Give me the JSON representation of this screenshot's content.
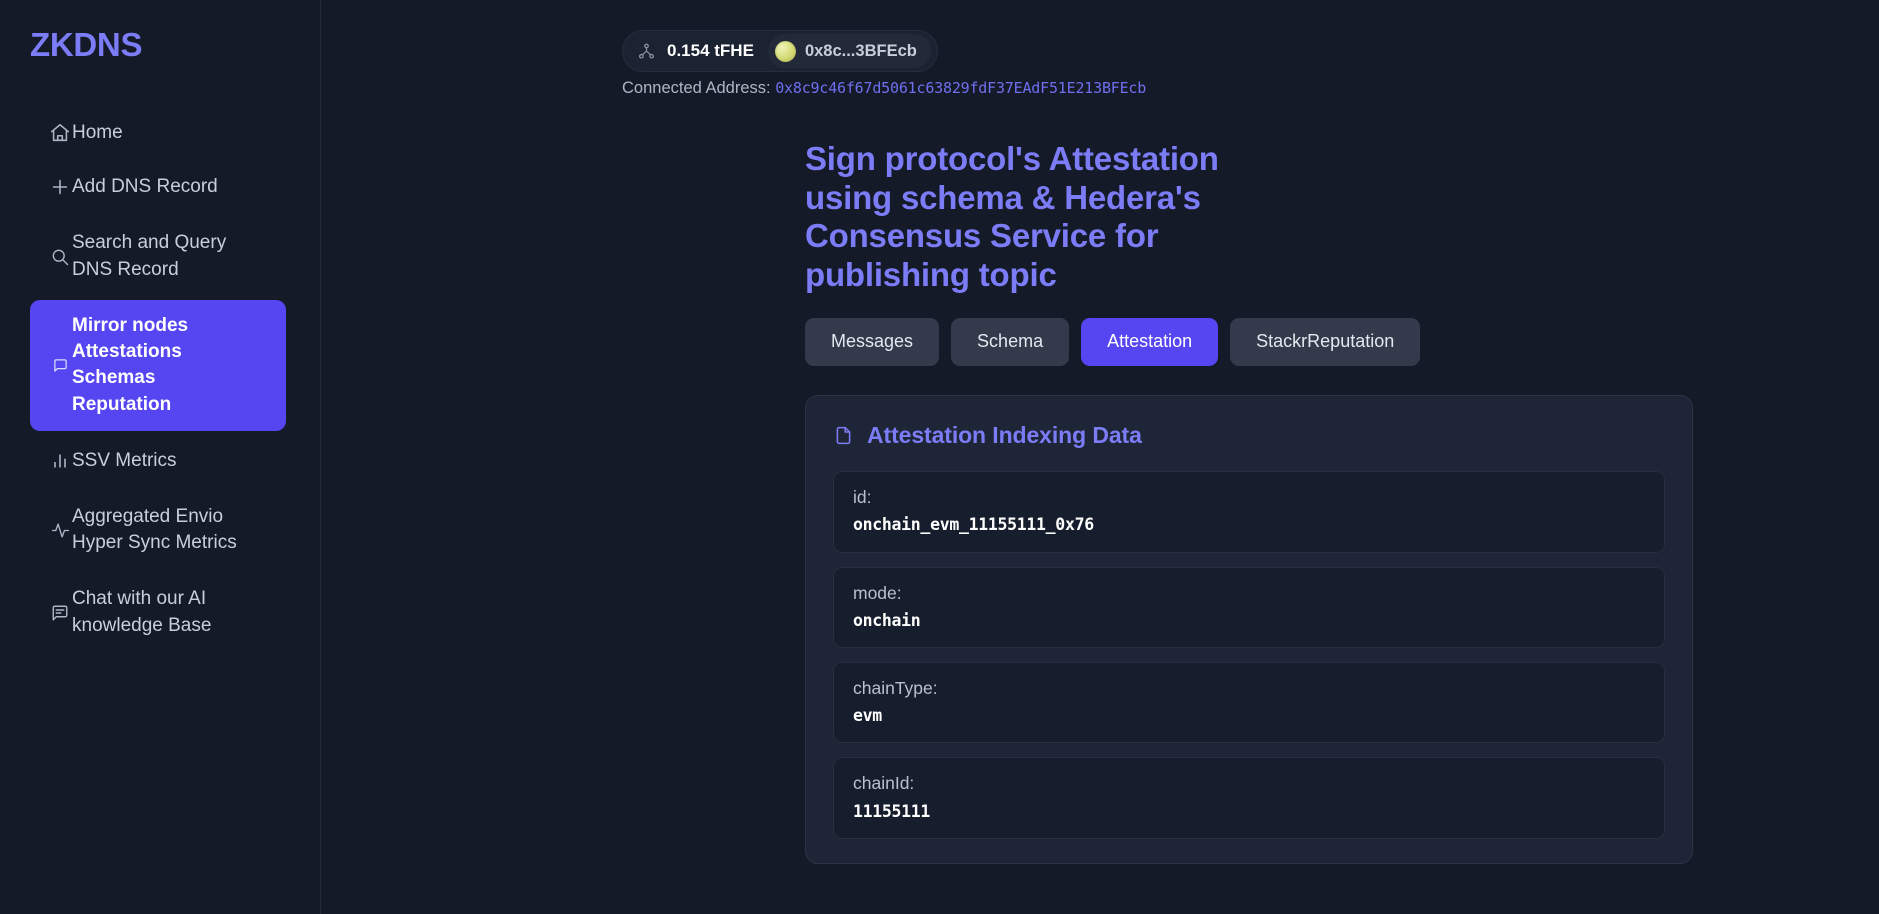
{
  "brand": "ZKDNS",
  "sidebar": {
    "items": [
      {
        "label": "Home",
        "icon": "home-icon",
        "name": "home",
        "active": false
      },
      {
        "label": "Add DNS Record",
        "icon": "plus-icon",
        "name": "add-dns-record",
        "active": false
      },
      {
        "label": "Search and Query\nDNS Record",
        "icon": "search-icon",
        "name": "search-and-query-dns-record",
        "active": false
      },
      {
        "label": "Mirror nodes\nAttestations Schemas\nReputation",
        "icon": "message-square-icon",
        "name": "mirror-nodes-attestations-schemas-reputation",
        "active": true
      },
      {
        "label": "SSV Metrics",
        "icon": "bar-chart-icon",
        "name": "ssv-metrics",
        "active": false
      },
      {
        "label": "Aggregated Envio\nHyper Sync Metrics",
        "icon": "activity-icon",
        "name": "aggregated-envio-hyper-sync-metrics",
        "active": false
      },
      {
        "label": "Chat with our AI\nknowledge Base",
        "icon": "chat-icon",
        "name": "chat-with-our-ai-knowledge-base",
        "active": false
      }
    ]
  },
  "wallet": {
    "balance": "0.154 tFHE",
    "account_short": "0x8c...3BFEcb",
    "connected_label": "Connected Address:",
    "connected_address": "0x8c9c46f67d5061c63829fdF37EAdF51E213BFEcb"
  },
  "main": {
    "page_title": "Sign protocol's Attestation using schema & Hedera's Consensus Service for publishing topic",
    "tabs": [
      {
        "label": "Messages",
        "active": false
      },
      {
        "label": "Schema",
        "active": false
      },
      {
        "label": "Attestation",
        "active": true
      },
      {
        "label": "StackrReputation",
        "active": false
      }
    ],
    "card": {
      "title": "Attestation Indexing Data",
      "rows": [
        {
          "key": "id:",
          "value": "onchain_evm_11155111_0x76"
        },
        {
          "key": "mode:",
          "value": "onchain"
        },
        {
          "key": "chainType:",
          "value": "evm"
        },
        {
          "key": "chainId:",
          "value": "11155111"
        }
      ]
    }
  },
  "colors": {
    "accent": "#5546f2",
    "accent_text": "#7c7cf7",
    "page_bg": "#141a27",
    "card_bg": "#1d2536",
    "row_bg": "#161d2c",
    "tab_bg": "#323a4b"
  }
}
